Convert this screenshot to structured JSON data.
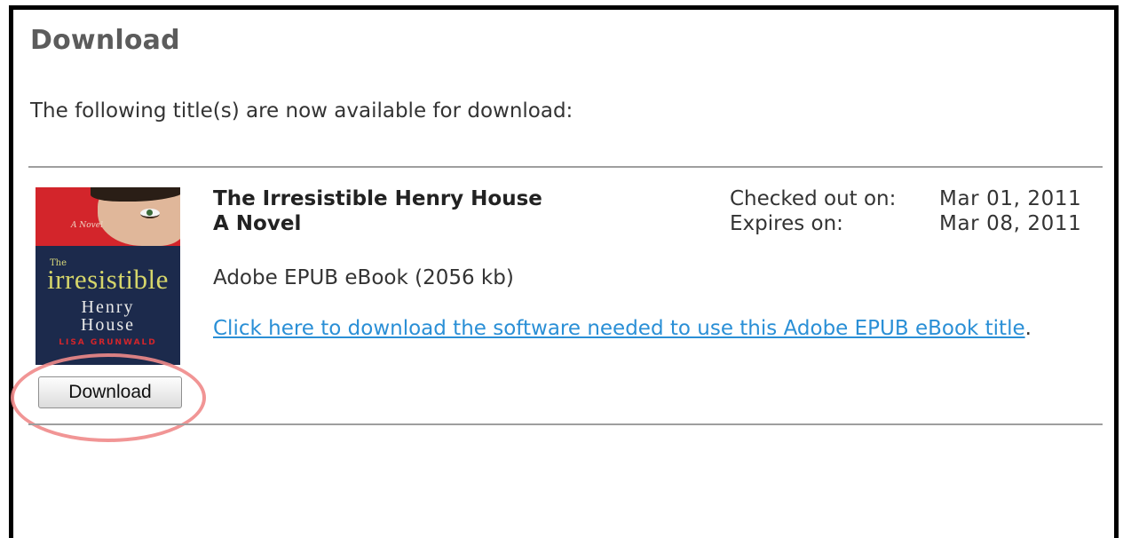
{
  "page": {
    "title": "Download",
    "intro": "The following title(s) are now available for download:"
  },
  "item": {
    "title": "The Irresistible Henry House",
    "subtitle": "A Novel",
    "format": "Adobe EPUB eBook (2056 kb)",
    "software_link_label": "Click here to download the software needed to use this Adobe EPUB eBook title",
    "software_link_suffix": ".",
    "checked_out_label": "Checked out on:",
    "checked_out_value": "Mar 01, 2011",
    "expires_label": "Expires on:",
    "expires_value": "Mar 08, 2011",
    "download_button": "Download",
    "cover": {
      "small_text": "A Novel",
      "the": "The",
      "word1": "irresistible",
      "word2": "Henry",
      "word3": "House",
      "author": "LISA GRUNWALD"
    }
  },
  "colors": {
    "link": "#2a8fd6",
    "title_gray": "#5c5c5c",
    "highlight": "#ef8a8a"
  }
}
